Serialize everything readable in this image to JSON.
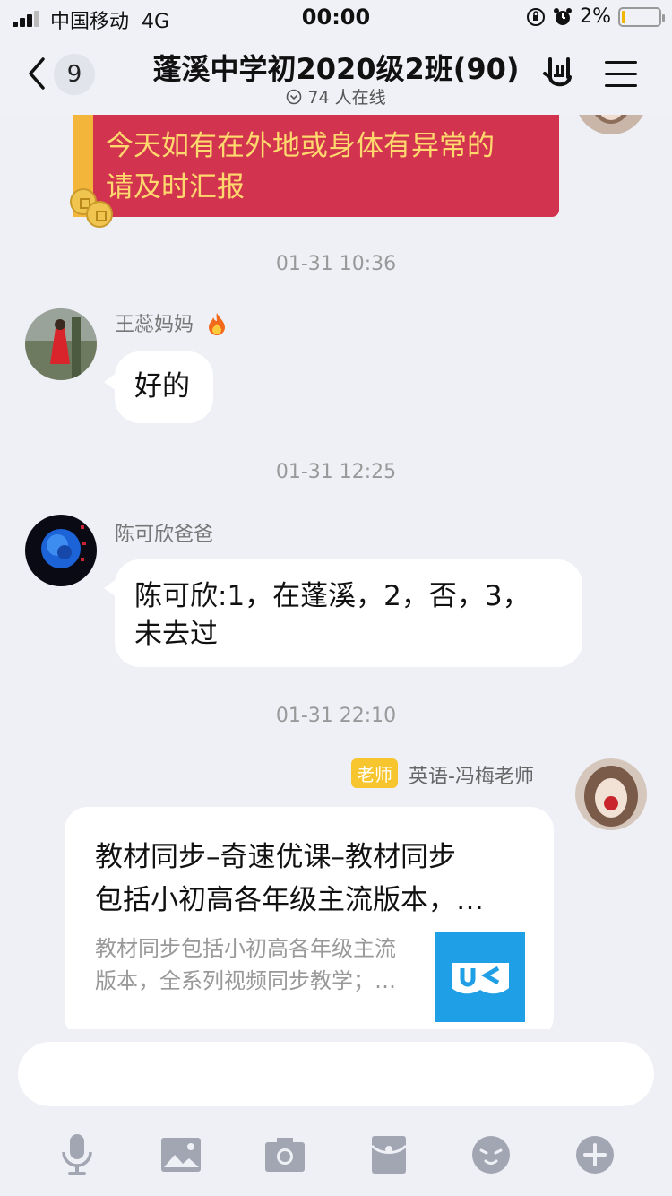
{
  "status_bar": {
    "carrier": "中国移动",
    "network": "4G",
    "time": "00:00",
    "battery_text": "2%",
    "battery_level": 0.02,
    "battery_color": "#f2b600"
  },
  "header": {
    "back_icon": "chevron-left-icon",
    "unread_count": "9",
    "title": "蓬溪中学初2020级2班(90)",
    "online_text": "74 人在线",
    "hand_icon": "rock-hand-icon",
    "menu_icon": "hamburger-menu-icon"
  },
  "messages": {
    "red_packet_text_line1": "今天如有在外地或身体有异常的",
    "red_packet_text_line2": "请及时汇报",
    "red_packet_color": "#d2344f",
    "ts1": "01-31 10:36",
    "msg1_sender": "王蕊妈妈",
    "msg1_sender_icon": "fire-icon",
    "msg1_text": "好的",
    "ts2": "01-31 12:25",
    "msg2_sender": "陈可欣爸爸",
    "msg2_line1": "陈可欣:1，在蓬溪，2，否，3，",
    "msg2_line2": "未去过",
    "ts3": "01-31 22:10",
    "msg3_role_tag": "老师",
    "msg3_sender": "英语-冯梅老师",
    "card_title_line1": "教材同步–奇速优课–教材同步",
    "card_title_line2": "包括小初高各年级主流版本，…",
    "card_desc_line1": "教材同步包括小初高各年级主流",
    "card_desc_line2": "版本，全系列视频同步教学；…",
    "card_thumb_text": "UK"
  },
  "toolbar": {
    "icons": [
      "microphone-icon",
      "image-icon",
      "camera-icon",
      "red-packet-icon",
      "emoji-icon",
      "plus-icon"
    ]
  }
}
